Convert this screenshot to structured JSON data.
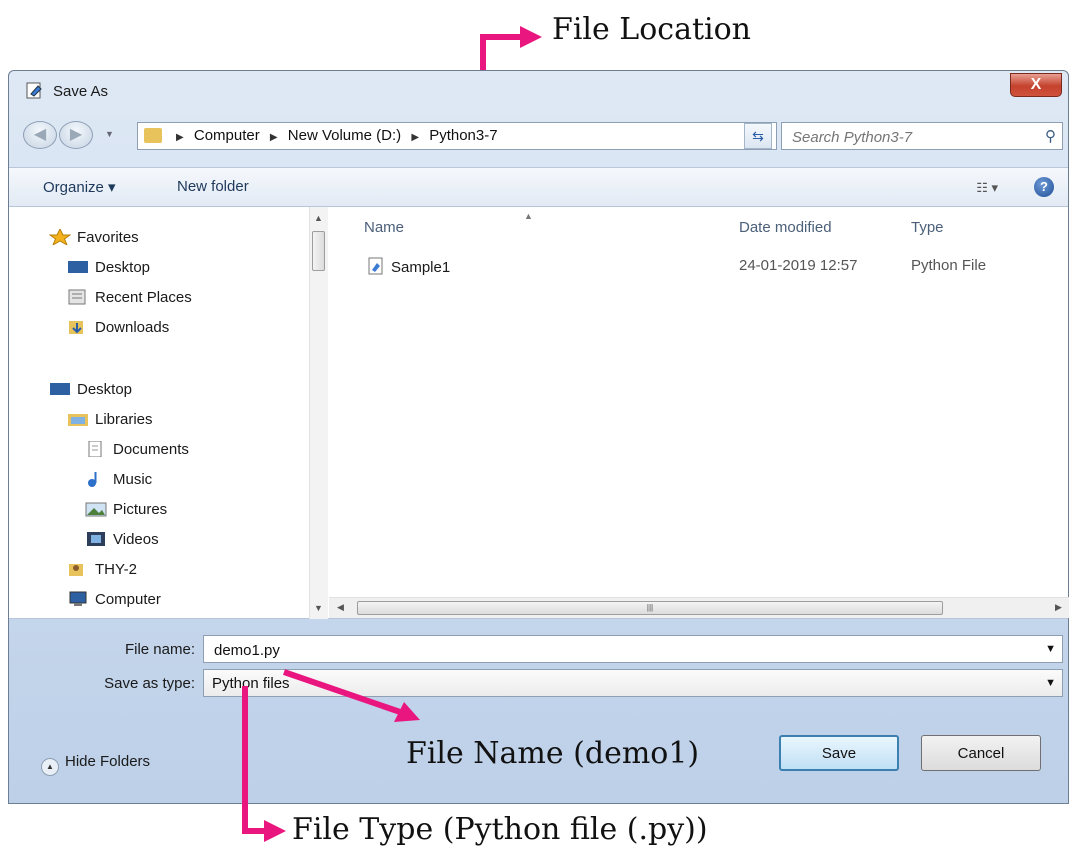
{
  "annotations": {
    "file_location": "File Location",
    "file_name": "File Name (demo1)",
    "file_type": "File Type (Python file (.py))"
  },
  "window": {
    "title": "Save As",
    "close_label": "X"
  },
  "address": {
    "crumbs": [
      "Computer",
      "New Volume (D:)",
      "Python3-7"
    ]
  },
  "search": {
    "placeholder": "Search Python3-7"
  },
  "toolbar": {
    "organize_label": "Organize ▾",
    "new_folder_label": "New folder",
    "help_label": "?"
  },
  "nav_pane": {
    "favorites": "Favorites",
    "items": [
      "Desktop",
      "Recent Places",
      "Downloads"
    ],
    "desktop": "Desktop",
    "libraries": "Libraries",
    "library_items": [
      "Documents",
      "Music",
      "Pictures",
      "Videos"
    ],
    "thy": "THY-2",
    "computer": "Computer"
  },
  "file_list": {
    "columns": [
      "Name",
      "Date modified",
      "Type"
    ],
    "rows": [
      {
        "name": "Sample1",
        "date": "24-01-2019 12:57",
        "type": "Python File"
      }
    ]
  },
  "form": {
    "file_name_label": "File name:",
    "file_name_value": "demo1.py",
    "save_type_label": "Save as type:",
    "save_type_value": "Python files"
  },
  "footer": {
    "hide_folders": "Hide Folders",
    "save_label": "Save",
    "cancel_label": "Cancel"
  },
  "colors": {
    "annotation": "#ea1680",
    "titlebar": "#c9d9ed",
    "close": "#c4422d"
  }
}
